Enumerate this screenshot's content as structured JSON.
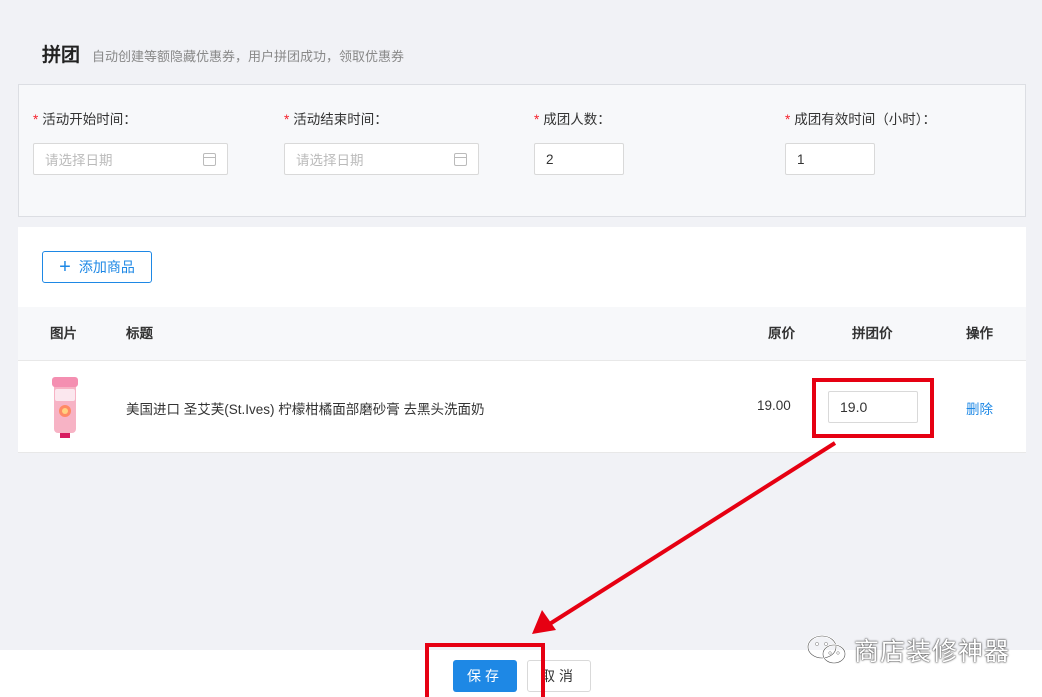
{
  "header": {
    "title": "拼团",
    "subtitle": "自动创建等额隐藏优惠券，用户拼团成功，领取优惠券"
  },
  "form": {
    "start_time": {
      "label": "活动开始时间：",
      "placeholder": "请选择日期"
    },
    "end_time": {
      "label": "活动结束时间：",
      "placeholder": "请选择日期"
    },
    "group_size": {
      "label": "成团人数：",
      "value": "2"
    },
    "valid_hours": {
      "label": "成团有效时间（小时）：",
      "value": "1"
    },
    "required_mark": "*"
  },
  "products": {
    "add_button": {
      "icon": "plus-icon",
      "label": "添加商品"
    },
    "columns": [
      "图片",
      "标题",
      "原价",
      "拼团价",
      "操作"
    ],
    "rows": [
      {
        "title": "美国进口 圣艾芙(St.Ives) 柠檬柑橘面部磨砂膏 去黑头洗面奶",
        "original_price": "19.00",
        "group_price": "19.0",
        "action": "删除"
      }
    ]
  },
  "footer": {
    "save_label": "保存",
    "cancel_label": "取消"
  },
  "watermark": {
    "icon": "wechat-icon",
    "text": "商店装修神器"
  },
  "colors": {
    "primary": "#1e88e5",
    "annotation": "#e60012",
    "required": "#f5222d"
  }
}
